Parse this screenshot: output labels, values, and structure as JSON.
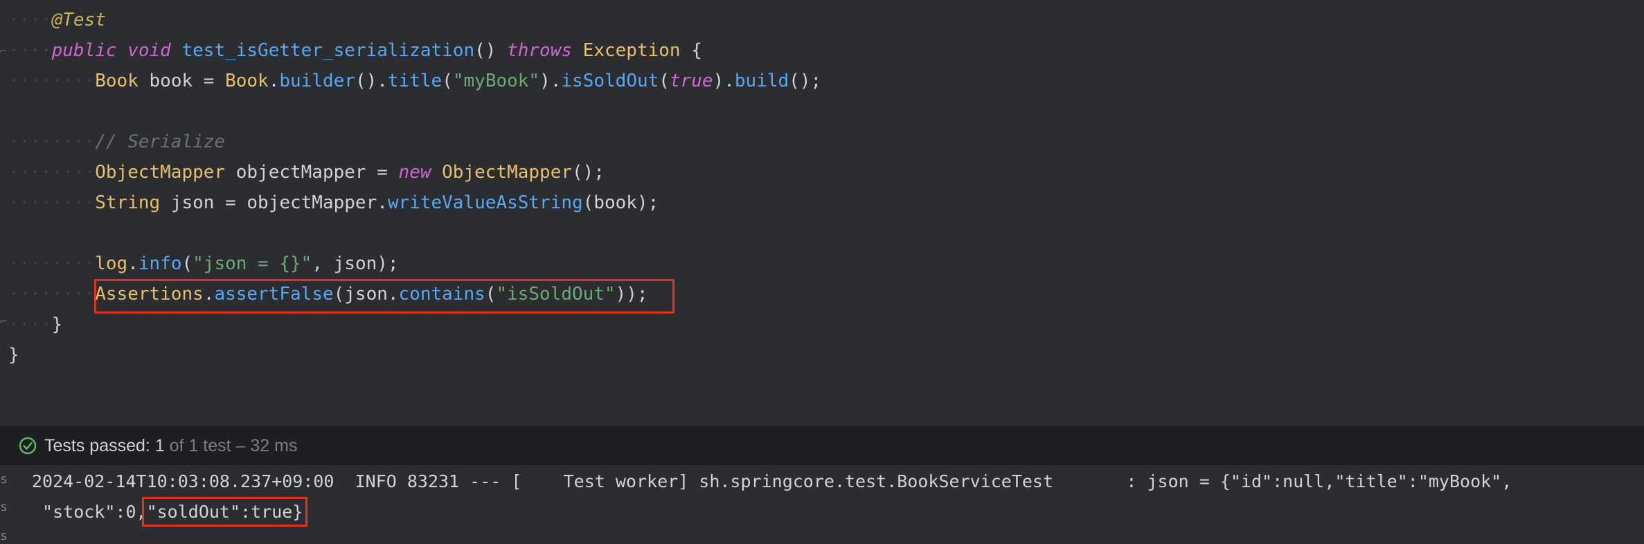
{
  "editor": {
    "lines": [
      {
        "ws": "····",
        "tokens": [
          {
            "t": "@Test",
            "c": "ann"
          }
        ]
      },
      {
        "ws": "····",
        "tokens": [
          {
            "t": "public",
            "c": "kw"
          },
          {
            "t": " ",
            "c": "plain"
          },
          {
            "t": "void",
            "c": "kw"
          },
          {
            "t": " ",
            "c": "plain"
          },
          {
            "t": "test_isGetter_serialization",
            "c": "fn"
          },
          {
            "t": "() ",
            "c": "plain"
          },
          {
            "t": "throws",
            "c": "kw"
          },
          {
            "t": " ",
            "c": "plain"
          },
          {
            "t": "Exception",
            "c": "type"
          },
          {
            "t": " {",
            "c": "plain"
          }
        ]
      },
      {
        "ws": "········",
        "tokens": [
          {
            "t": "Book",
            "c": "type"
          },
          {
            "t": " book = ",
            "c": "plain"
          },
          {
            "t": "Book",
            "c": "type"
          },
          {
            "t": ".",
            "c": "plain"
          },
          {
            "t": "builder",
            "c": "fn"
          },
          {
            "t": "().",
            "c": "plain"
          },
          {
            "t": "title",
            "c": "fn"
          },
          {
            "t": "(",
            "c": "plain"
          },
          {
            "t": "\"myBook\"",
            "c": "str"
          },
          {
            "t": ").",
            "c": "plain"
          },
          {
            "t": "isSoldOut",
            "c": "fn"
          },
          {
            "t": "(",
            "c": "plain"
          },
          {
            "t": "true",
            "c": "kw"
          },
          {
            "t": ").",
            "c": "plain"
          },
          {
            "t": "build",
            "c": "fn"
          },
          {
            "t": "();",
            "c": "plain"
          }
        ]
      },
      {
        "ws": "",
        "tokens": []
      },
      {
        "ws": "········",
        "tokens": [
          {
            "t": "// Serialize",
            "c": "cmt"
          }
        ]
      },
      {
        "ws": "········",
        "tokens": [
          {
            "t": "ObjectMapper",
            "c": "type"
          },
          {
            "t": " objectMapper = ",
            "c": "plain"
          },
          {
            "t": "new",
            "c": "kw"
          },
          {
            "t": " ",
            "c": "plain"
          },
          {
            "t": "ObjectMapper",
            "c": "type"
          },
          {
            "t": "();",
            "c": "plain"
          }
        ]
      },
      {
        "ws": "········",
        "tokens": [
          {
            "t": "String",
            "c": "type"
          },
          {
            "t": " json = objectMapper.",
            "c": "plain"
          },
          {
            "t": "writeValueAsString",
            "c": "fn"
          },
          {
            "t": "(book);",
            "c": "plain"
          }
        ]
      },
      {
        "ws": "",
        "tokens": []
      },
      {
        "ws": "········",
        "tokens": [
          {
            "t": "log",
            "c": "type"
          },
          {
            "t": ".",
            "c": "plain"
          },
          {
            "t": "info",
            "c": "fn"
          },
          {
            "t": "(",
            "c": "plain"
          },
          {
            "t": "\"json = {}\"",
            "c": "str"
          },
          {
            "t": ", json);",
            "c": "plain"
          }
        ]
      },
      {
        "ws": "········",
        "tokens": [
          {
            "t": "Assertions",
            "c": "type"
          },
          {
            "t": ".",
            "c": "plain"
          },
          {
            "t": "assertFalse",
            "c": "fn"
          },
          {
            "t": "(json.",
            "c": "plain"
          },
          {
            "t": "contains",
            "c": "fn"
          },
          {
            "t": "(",
            "c": "plain"
          },
          {
            "t": "\"isSoldOut\"",
            "c": "str"
          },
          {
            "t": "));",
            "c": "plain"
          }
        ]
      },
      {
        "ws": "····",
        "tokens": [
          {
            "t": "}",
            "c": "plain"
          }
        ]
      },
      {
        "ws": "",
        "tokens": [
          {
            "t": "}",
            "c": "plain"
          }
        ]
      }
    ]
  },
  "status": {
    "label": "Tests passed: ",
    "passed": "1",
    "detail": " of 1 test – 32 ms"
  },
  "console": {
    "line1": "2024-02-14T10:03:08.237+09:00  INFO 83231 --- [    Test worker] sh.springcore.test.BookServiceTest       : json = {\"id\":null,\"title\":\"myBook\",",
    "line2_prefix": " \"stock\":0,",
    "line2_highlight": "\"soldOut\":true}",
    "side_marks": [
      "s",
      "s",
      "s"
    ]
  },
  "colors": {
    "highlight_box": "#e0321c",
    "check": "#5fb865"
  }
}
